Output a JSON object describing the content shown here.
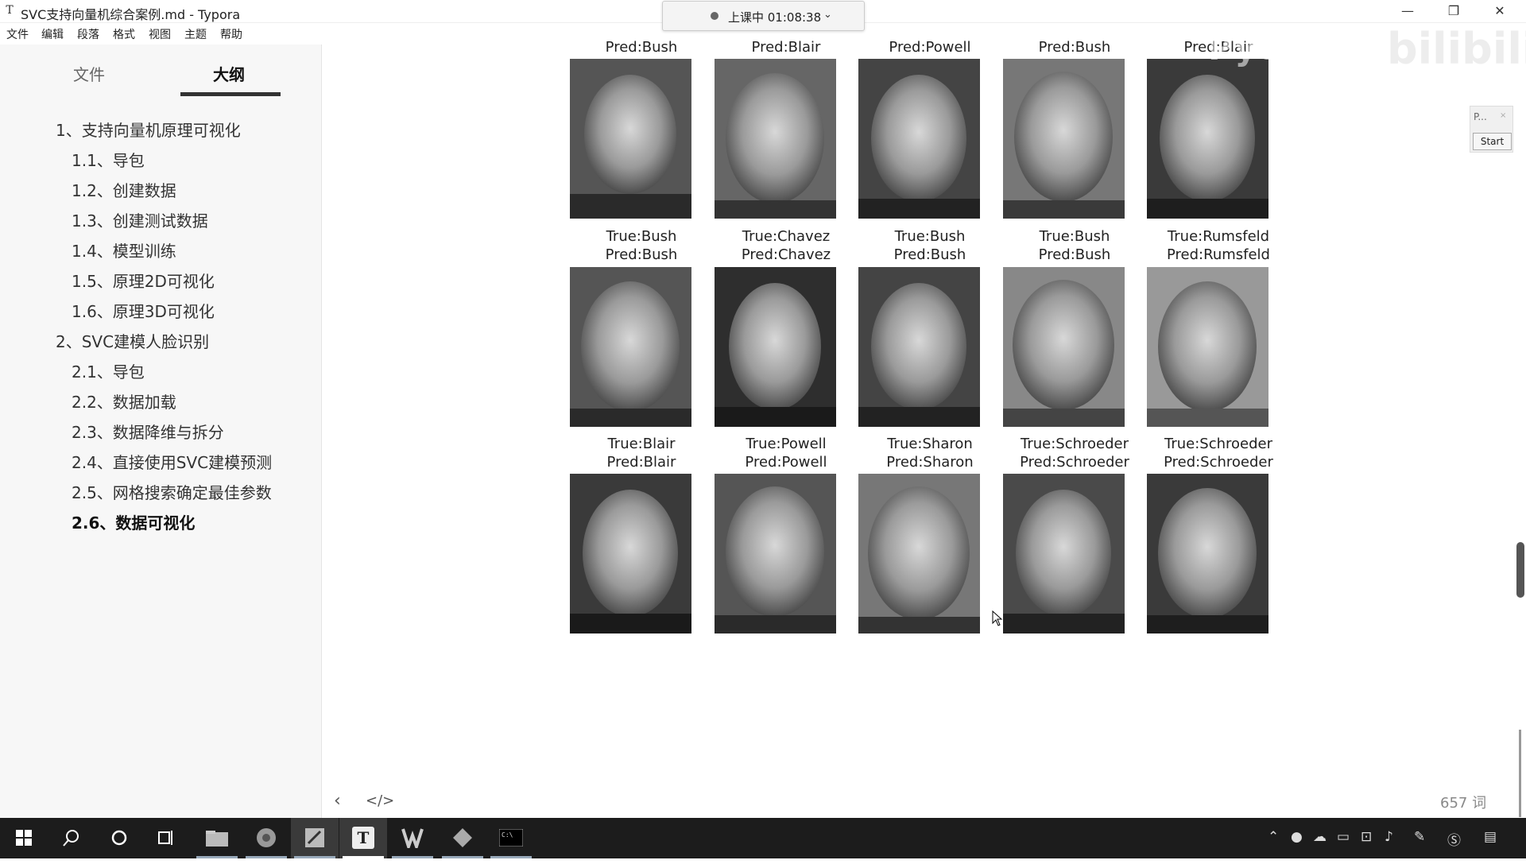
{
  "window": {
    "title": "SVC支持向量机综合案例.md - Typora",
    "app_icon": "T",
    "minimize_icon": "—",
    "maximize_icon": "❐",
    "close_icon": "✕"
  },
  "recording": {
    "status": "上课中 01:08:38",
    "chevron": "⌄"
  },
  "menu": [
    "文件",
    "编辑",
    "段落",
    "格式",
    "视图",
    "主题",
    "帮助"
  ],
  "sidebar": {
    "tabs": [
      "文件",
      "大纲"
    ],
    "active_tab": "大纲",
    "outline": [
      {
        "label": "1、支持向量机原理可视化",
        "level": 1
      },
      {
        "label": "1.1、导包",
        "level": 2
      },
      {
        "label": "1.2、创建数据",
        "level": 2
      },
      {
        "label": "1.3、创建测试数据",
        "level": 2
      },
      {
        "label": "1.4、模型训练",
        "level": 2
      },
      {
        "label": "1.5、原理2D可视化",
        "level": 2
      },
      {
        "label": "1.6、原理3D可视化",
        "level": 2
      },
      {
        "label": "2、SVC建模人脸识别",
        "level": 1
      },
      {
        "label": "2.1、导包",
        "level": 2
      },
      {
        "label": "2.2、数据加载",
        "level": 2
      },
      {
        "label": "2.3、数据降维与拆分",
        "level": 2
      },
      {
        "label": "2.4、直接使用SVC建模预测",
        "level": 2
      },
      {
        "label": "2.5、网格搜索确定最佳参数",
        "level": 2
      },
      {
        "label": "2.6、数据可视化",
        "level": 2,
        "active": true
      }
    ]
  },
  "faces": {
    "row0_labels": [
      {
        "pred": "Pred:Bush"
      },
      {
        "pred": "Pred:Blair"
      },
      {
        "pred": "Pred:Powell"
      },
      {
        "pred": "Pred:Bush"
      },
      {
        "pred": "Pred:Blair"
      }
    ],
    "row1_labels": [
      {
        "true": "True:Bush",
        "pred": "Pred:Bush"
      },
      {
        "true": "True:Chavez",
        "pred": "Pred:Chavez"
      },
      {
        "true": "True:Bush",
        "pred": "Pred:Bush"
      },
      {
        "true": "True:Bush",
        "pred": "Pred:Bush"
      },
      {
        "true": "True:Rumsfeld",
        "pred": "Pred:Rumsfeld"
      }
    ],
    "row2_labels": [
      {
        "true": "True:Blair",
        "pred": "Pred:Blair"
      },
      {
        "true": "True:Powell",
        "pred": "Pred:Powell"
      },
      {
        "true": "True:Sharon",
        "pred": "Pred:Sharon"
      },
      {
        "true": "True:Schroeder",
        "pred": "Pred:Schroeder"
      },
      {
        "true": "True:Schroeder",
        "pred": "Pred:Schroeder"
      }
    ]
  },
  "watermark": {
    "text": "Pyth",
    "brand": "bilibili"
  },
  "mini_panel": {
    "title": "P...",
    "close": "×",
    "button": "Start"
  },
  "footer": {
    "back_icon": "‹",
    "code_icon": "</>",
    "word_count": "657 词"
  },
  "taskbar": {
    "items": [
      "windows-start-icon",
      "search-icon",
      "cortana-icon",
      "task-view-icon",
      "file-explorer-icon",
      "chrome-icon",
      "paint-icon",
      "typora-icon",
      "wps-icon",
      "vscode-icon",
      "terminal-icon"
    ],
    "active": "typora-icon"
  }
}
